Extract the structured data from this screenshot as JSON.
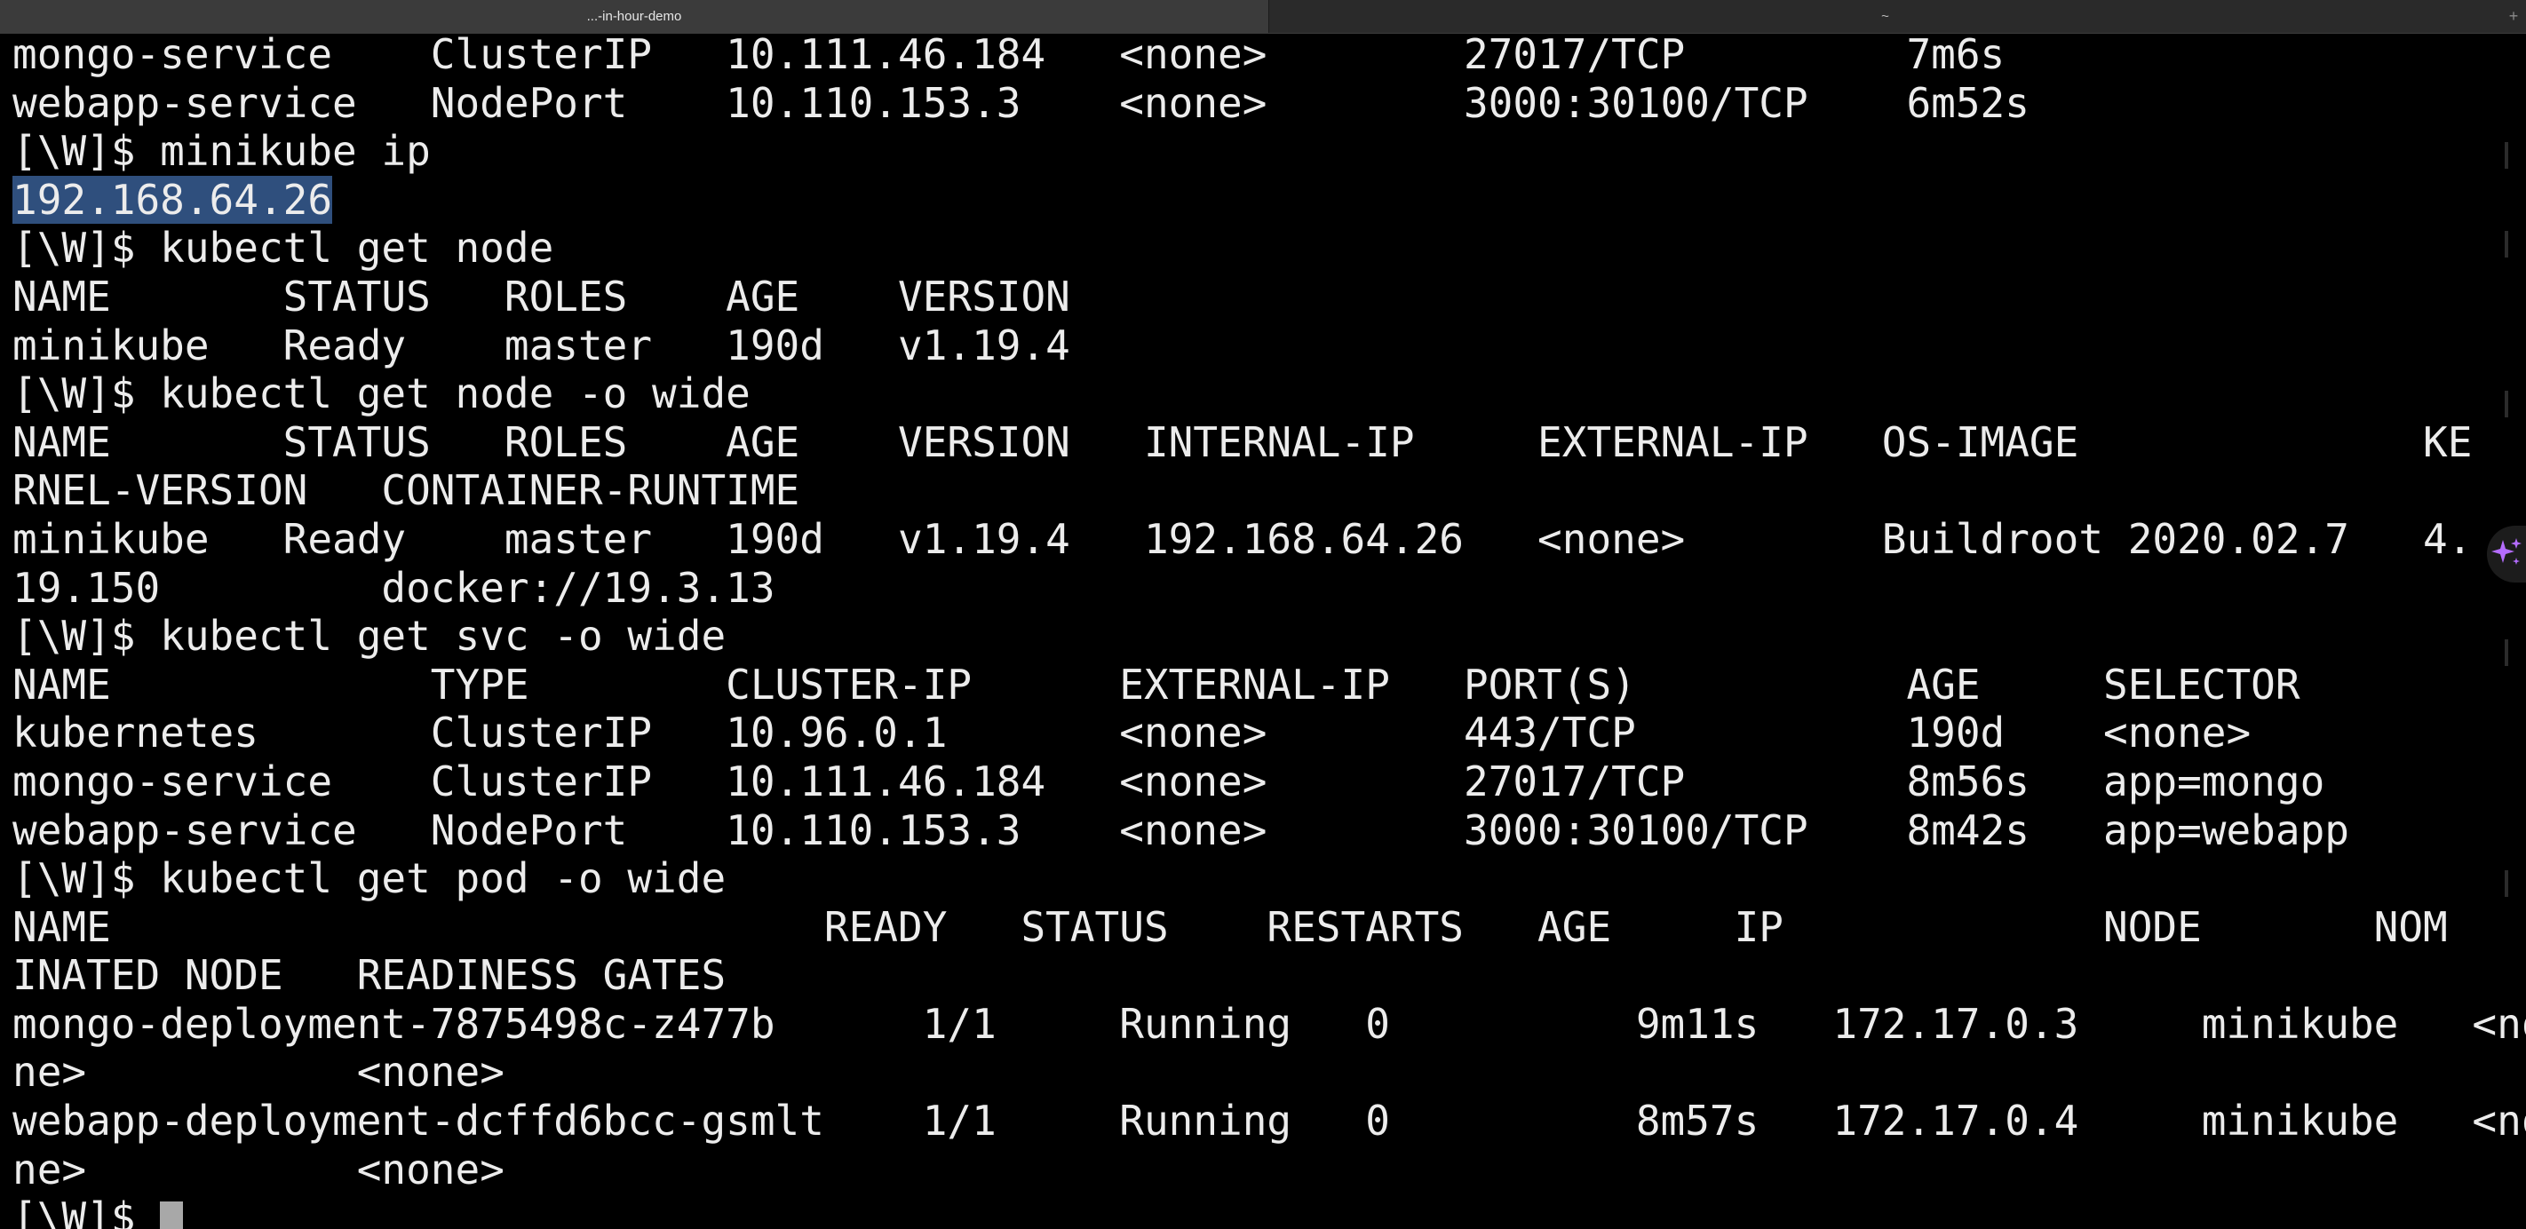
{
  "window": {
    "tabs": [
      {
        "label": "...-in-hour-demo",
        "active": true
      },
      {
        "label": "~",
        "active": false
      }
    ]
  },
  "colors": {
    "background": "#000000",
    "text": "#ececec",
    "selection": "#2f4f7d",
    "accent": "#b46cff"
  },
  "icons": {
    "ai": "sparkle-icon",
    "new_tab": "plus-icon"
  },
  "terminal": {
    "lines": [
      "mongo-service    ClusterIP   10.111.46.184   <none>        27017/TCP         7m6s",
      "webapp-service   NodePort    10.110.153.3    <none>        3000:30100/TCP    6m52s",
      "[\\W]$ minikube ip",
      "192.168.64.26",
      "[\\W]$ kubectl get node",
      "NAME       STATUS   ROLES    AGE    VERSION",
      "minikube   Ready    master   190d   v1.19.4",
      "[\\W]$ kubectl get node -o wide",
      "NAME       STATUS   ROLES    AGE    VERSION   INTERNAL-IP     EXTERNAL-IP   OS-IMAGE              KE",
      "RNEL-VERSION   CONTAINER-RUNTIME",
      "minikube   Ready    master   190d   v1.19.4   192.168.64.26   <none>        Buildroot 2020.02.7   4.",
      "19.150         docker://19.3.13",
      "[\\W]$ kubectl get svc -o wide",
      "NAME             TYPE        CLUSTER-IP      EXTERNAL-IP   PORT(S)           AGE     SELECTOR",
      "kubernetes       ClusterIP   10.96.0.1       <none>        443/TCP           190d    <none>",
      "mongo-service    ClusterIP   10.111.46.184   <none>        27017/TCP         8m56s   app=mongo",
      "webapp-service   NodePort    10.110.153.3    <none>        3000:30100/TCP    8m42s   app=webapp",
      "[\\W]$ kubectl get pod -o wide",
      "NAME                             READY   STATUS    RESTARTS   AGE     IP             NODE       NOM",
      "INATED NODE   READINESS GATES",
      "mongo-deployment-7875498c-z477b      1/1     Running   0          9m11s   172.17.0.3     minikube   <no",
      "ne>           <none>",
      "webapp-deployment-dcffd6bcc-gsmlt    1/1     Running   0          8m57s   172.17.0.4     minikube   <no",
      "ne>           <none>"
    ],
    "selected_text": "192.168.64.26",
    "prompt": "[\\W]$ "
  }
}
